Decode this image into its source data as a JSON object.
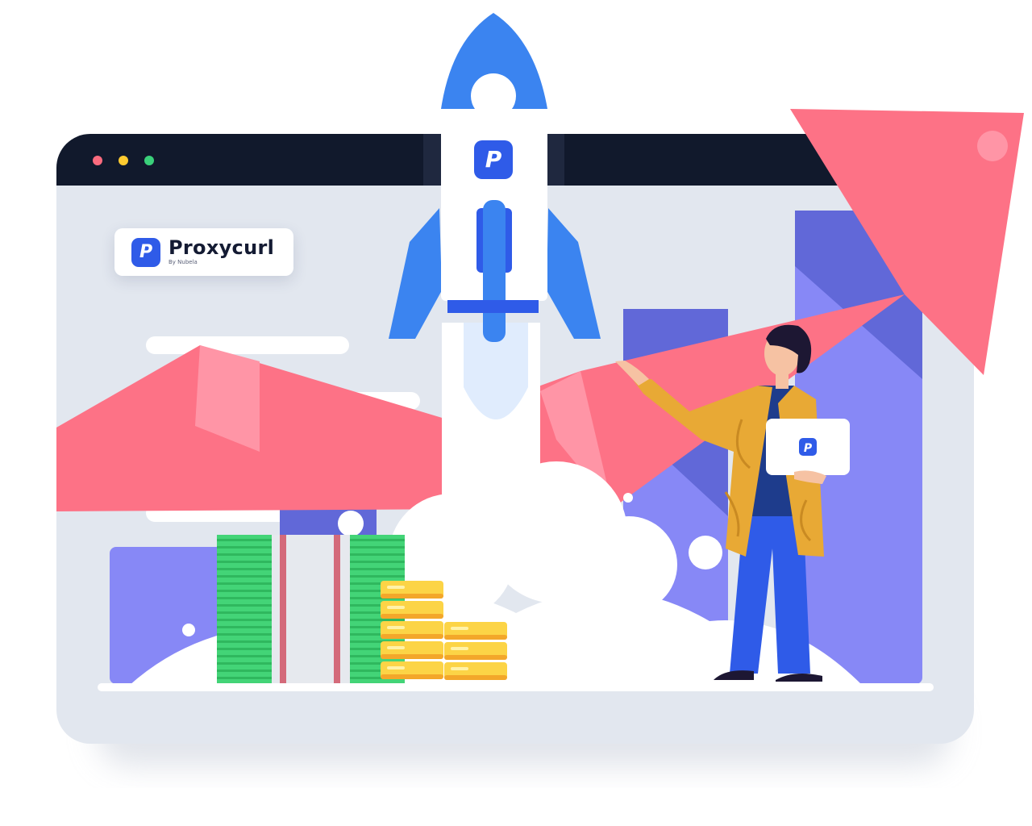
{
  "brand": {
    "name": "Proxycurl",
    "tagline": "By Nubela",
    "logo_glyph": "P",
    "logo_icon": "proxycurl-p-logo-icon"
  },
  "window": {
    "titlebar_dots": [
      "close-dot",
      "minimize-dot",
      "maximize-dot"
    ]
  },
  "illustration": {
    "rocket_badge_glyph": "P",
    "sign_badge_glyph": "P"
  },
  "colors": {
    "titlebar": "#11192c",
    "window_bg": "#e2e7ef",
    "arrow": "#fd7286",
    "rocket": "#3b84f0",
    "bars": "#8788f6",
    "money": "#43d477",
    "coins": "#fcd446",
    "brand_accent": "#2f5be8",
    "dot_red": "#fb6b7e",
    "dot_yellow": "#ffcb30",
    "dot_green": "#3ad07a"
  }
}
